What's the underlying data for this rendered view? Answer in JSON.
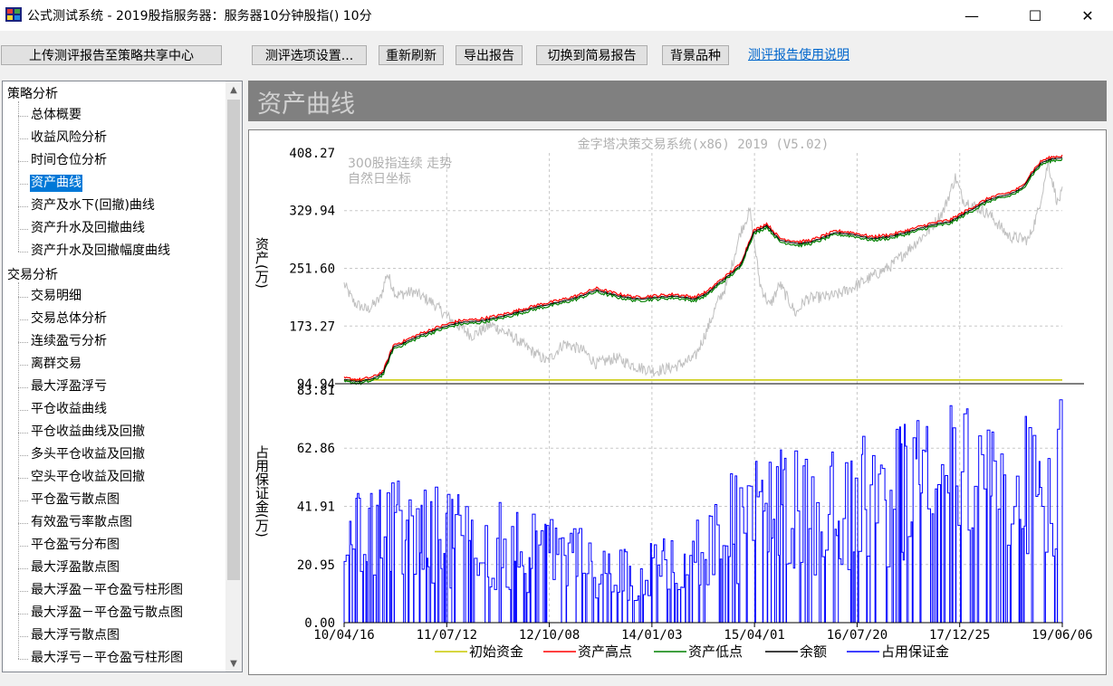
{
  "window": {
    "title": "公式测试系统 - 2019股指服务器：服务器10分钟股指() 10分",
    "minimize": "—",
    "maximize": "☐",
    "close": "✕"
  },
  "toolbar": {
    "upload": "上传测评报告至策略共享中心",
    "settings": "测评选项设置...",
    "refresh": "重新刷新",
    "export": "导出报告",
    "switch": "切换到简易报告",
    "background": "背景品种",
    "help": "测评报告使用说明"
  },
  "tree": {
    "cat1": "策略分析",
    "cat1_items": [
      "总体概要",
      "收益风险分析",
      "时间仓位分析",
      "资产曲线",
      "资产及水下(回撤)曲线",
      "资产升水及回撤曲线",
      "资产升水及回撤幅度曲线"
    ],
    "cat2": "交易分析",
    "cat2_items": [
      "交易明细",
      "交易总体分析",
      "连续盈亏分析",
      "离群交易",
      "最大浮盈浮亏",
      "平仓收益曲线",
      "平仓收益曲线及回撤",
      "多头平仓收益及回撤",
      "空头平仓收益及回撤",
      "平仓盈亏散点图",
      "有效盈亏率散点图",
      "平仓盈亏分布图",
      "最大浮盈散点图",
      "最大浮盈－平仓盈亏柱形图",
      "最大浮盈－平仓盈亏散点图",
      "最大浮亏散点图",
      "最大浮亏－平仓盈亏柱形图"
    ],
    "selected": "资产曲线",
    "scroll_up": "▲",
    "scroll_down": "▼"
  },
  "section": {
    "title": "资产曲线"
  },
  "chart_data": {
    "type": "line",
    "title": "金字塔决策交易系统(x86) 2019 (V5.02)",
    "annotation_lines": [
      "300股指连续 走势",
      "自然日坐标"
    ],
    "x_ticks": [
      "10/04/16",
      "11/07/12",
      "12/10/08",
      "14/01/03",
      "15/04/01",
      "16/07/20",
      "17/12/25",
      "19/06/06"
    ],
    "x_range": [
      "2010-04-16",
      "2019-06-06"
    ],
    "upper": {
      "ylabel": "资产(万)",
      "y_ticks": [
        "408.27",
        "329.94",
        "251.60",
        "173.27",
        "94.94"
      ],
      "ylim": [
        94.94,
        408.27
      ],
      "initial_capital": 100,
      "equity": [
        [
          "2010-04-16",
          100
        ],
        [
          "2010-07-01",
          98
        ],
        [
          "2010-09-01",
          102
        ],
        [
          "2010-10-15",
          110
        ],
        [
          "2010-12-01",
          145
        ],
        [
          "2011-01-15",
          150
        ],
        [
          "2011-04-01",
          160
        ],
        [
          "2011-07-01",
          170
        ],
        [
          "2011-10-01",
          178
        ],
        [
          "2012-01-01",
          180
        ],
        [
          "2012-04-01",
          185
        ],
        [
          "2012-07-01",
          192
        ],
        [
          "2012-10-08",
          200
        ],
        [
          "2013-01-01",
          205
        ],
        [
          "2013-04-01",
          212
        ],
        [
          "2013-07-01",
          222
        ],
        [
          "2013-10-01",
          215
        ],
        [
          "2014-01-03",
          210
        ],
        [
          "2014-04-01",
          212
        ],
        [
          "2014-07-01",
          214
        ],
        [
          "2014-10-01",
          210
        ],
        [
          "2014-12-01",
          218
        ],
        [
          "2015-01-15",
          230
        ],
        [
          "2015-03-01",
          240
        ],
        [
          "2015-05-01",
          255
        ],
        [
          "2015-07-01",
          300
        ],
        [
          "2015-09-01",
          310
        ],
        [
          "2015-11-01",
          290
        ],
        [
          "2016-02-01",
          285
        ],
        [
          "2016-04-01",
          288
        ],
        [
          "2016-07-20",
          300
        ],
        [
          "2016-10-01",
          298
        ],
        [
          "2017-01-01",
          292
        ],
        [
          "2017-04-01",
          295
        ],
        [
          "2017-07-01",
          302
        ],
        [
          "2017-10-01",
          310
        ],
        [
          "2018-01-01",
          315
        ],
        [
          "2018-04-01",
          330
        ],
        [
          "2018-07-01",
          345
        ],
        [
          "2018-10-01",
          352
        ],
        [
          "2018-12-01",
          360
        ],
        [
          "2019-01-15",
          380
        ],
        [
          "2019-03-01",
          395
        ],
        [
          "2019-04-15",
          400
        ],
        [
          "2019-06-06",
          402
        ]
      ],
      "benchmark": [
        [
          "2010-04-16",
          230
        ],
        [
          "2010-06-01",
          205
        ],
        [
          "2010-08-01",
          195
        ],
        [
          "2010-10-01",
          210
        ],
        [
          "2010-11-01",
          245
        ],
        [
          "2010-12-15",
          215
        ],
        [
          "2011-03-01",
          220
        ],
        [
          "2011-06-01",
          205
        ],
        [
          "2011-09-01",
          180
        ],
        [
          "2011-12-01",
          160
        ],
        [
          "2012-03-01",
          175
        ],
        [
          "2012-06-01",
          160
        ],
        [
          "2012-09-01",
          140
        ],
        [
          "2012-11-15",
          125
        ],
        [
          "2013-02-01",
          150
        ],
        [
          "2013-05-01",
          140
        ],
        [
          "2013-07-01",
          122
        ],
        [
          "2013-10-01",
          130
        ],
        [
          "2014-01-03",
          118
        ],
        [
          "2014-04-01",
          112
        ],
        [
          "2014-07-01",
          118
        ],
        [
          "2014-10-01",
          130
        ],
        [
          "2014-12-01",
          170
        ],
        [
          "2015-01-15",
          205
        ],
        [
          "2015-03-01",
          230
        ],
        [
          "2015-05-01",
          300
        ],
        [
          "2015-06-15",
          330
        ],
        [
          "2015-08-01",
          230
        ],
        [
          "2015-09-15",
          200
        ],
        [
          "2015-11-01",
          230
        ],
        [
          "2016-01-15",
          190
        ],
        [
          "2016-03-01",
          210
        ],
        [
          "2016-07-20",
          215
        ],
        [
          "2016-10-01",
          225
        ],
        [
          "2017-01-01",
          240
        ],
        [
          "2017-04-01",
          255
        ],
        [
          "2017-07-01",
          280
        ],
        [
          "2017-10-01",
          305
        ],
        [
          "2017-12-01",
          330
        ],
        [
          "2018-01-25",
          375
        ],
        [
          "2018-03-01",
          345
        ],
        [
          "2018-07-01",
          325
        ],
        [
          "2018-10-01",
          295
        ],
        [
          "2018-12-31",
          290
        ],
        [
          "2019-02-15",
          330
        ],
        [
          "2019-04-01",
          395
        ],
        [
          "2019-05-15",
          340
        ],
        [
          "2019-06-06",
          355
        ]
      ]
    },
    "lower": {
      "ylabel": "占用保证金(万)",
      "y_ticks": [
        "83.81",
        "62.86",
        "41.91",
        "20.95",
        "0.00"
      ],
      "ylim": [
        0,
        83.81
      ],
      "margin_envelope": [
        [
          "2010-04-16",
          48
        ],
        [
          "2010-10-01",
          52
        ],
        [
          "2011-07-12",
          50
        ],
        [
          "2012-06-01",
          44
        ],
        [
          "2013-01-01",
          38
        ],
        [
          "2013-06-01",
          35
        ],
        [
          "2014-01-03",
          25
        ],
        [
          "2014-06-01",
          35
        ],
        [
          "2014-12-01",
          45
        ],
        [
          "2015-06-01",
          60
        ],
        [
          "2016-07-20",
          68
        ],
        [
          "2017-06-01",
          72
        ],
        [
          "2017-12-25",
          80
        ],
        [
          "2018-08-01",
          75
        ],
        [
          "2019-01-01",
          78
        ],
        [
          "2019-06-06",
          82
        ]
      ]
    },
    "series": [
      {
        "name": "初始资金",
        "color": "#c8c800"
      },
      {
        "name": "资产高点",
        "color": "#ff0000"
      },
      {
        "name": "资产低点",
        "color": "#008000"
      },
      {
        "name": "余额",
        "color": "#000000"
      },
      {
        "name": "占用保证金",
        "color": "#0000ff"
      }
    ],
    "benchmark_color": "#c0c0c0"
  }
}
